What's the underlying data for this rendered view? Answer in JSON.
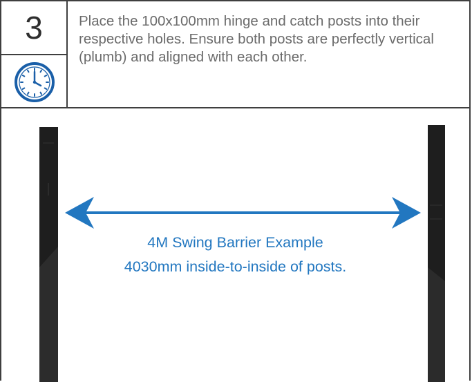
{
  "step": {
    "number": "3",
    "icon": "clock-icon",
    "instruction": "Place the 100x100mm hinge and catch posts into their respective holes. Ensure both posts are perfectly vertical (plumb) and aligned with each other."
  },
  "illustration": {
    "caption_line_1": "4M Swing Barrier Example",
    "caption_line_2": "4030mm inside-to-inside of posts.",
    "arrow_color": "#2277c0",
    "post_color": "#1e1e1e"
  }
}
